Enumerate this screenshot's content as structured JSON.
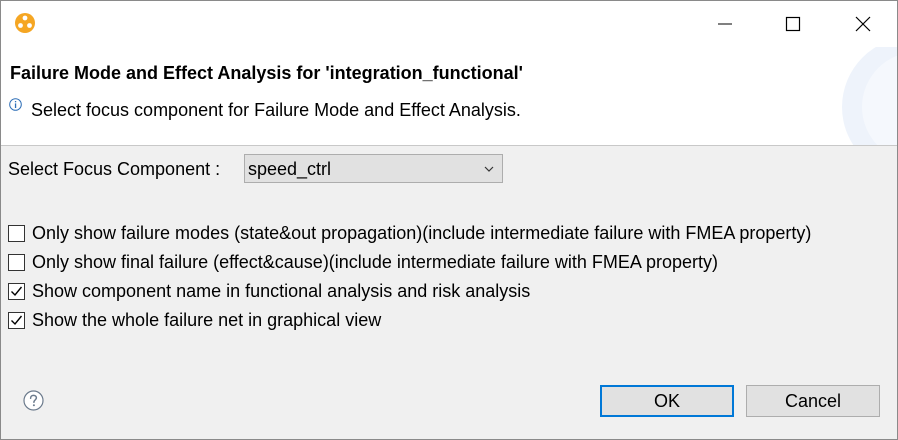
{
  "window": {
    "app_icon": "app-logo-icon",
    "controls": [
      "minimize-icon",
      "maximize-icon",
      "close-icon"
    ]
  },
  "header": {
    "title": "Failure Mode and Effect Analysis for 'integration_functional'",
    "message": "Select focus component for Failure Mode and Effect Analysis.",
    "message_icon": "info-icon"
  },
  "focus": {
    "label": "Select Focus Component :",
    "selected": "speed_ctrl"
  },
  "options": [
    {
      "label": "Only show failure modes (state&out propagation)(include intermediate failure with FMEA property)",
      "checked": false
    },
    {
      "label": "Only show final failure (effect&cause)(include intermediate failure with FMEA property)",
      "checked": false
    },
    {
      "label": "Show component name in functional analysis and risk analysis",
      "checked": true
    },
    {
      "label": "Show the whole failure net in graphical view",
      "checked": true
    }
  ],
  "buttons": {
    "ok": "OK",
    "cancel": "Cancel",
    "help_icon": "help-icon"
  },
  "colors": {
    "accent": "#0078d7",
    "app_icon": "#f5a623",
    "background": "#f0f0f0"
  }
}
